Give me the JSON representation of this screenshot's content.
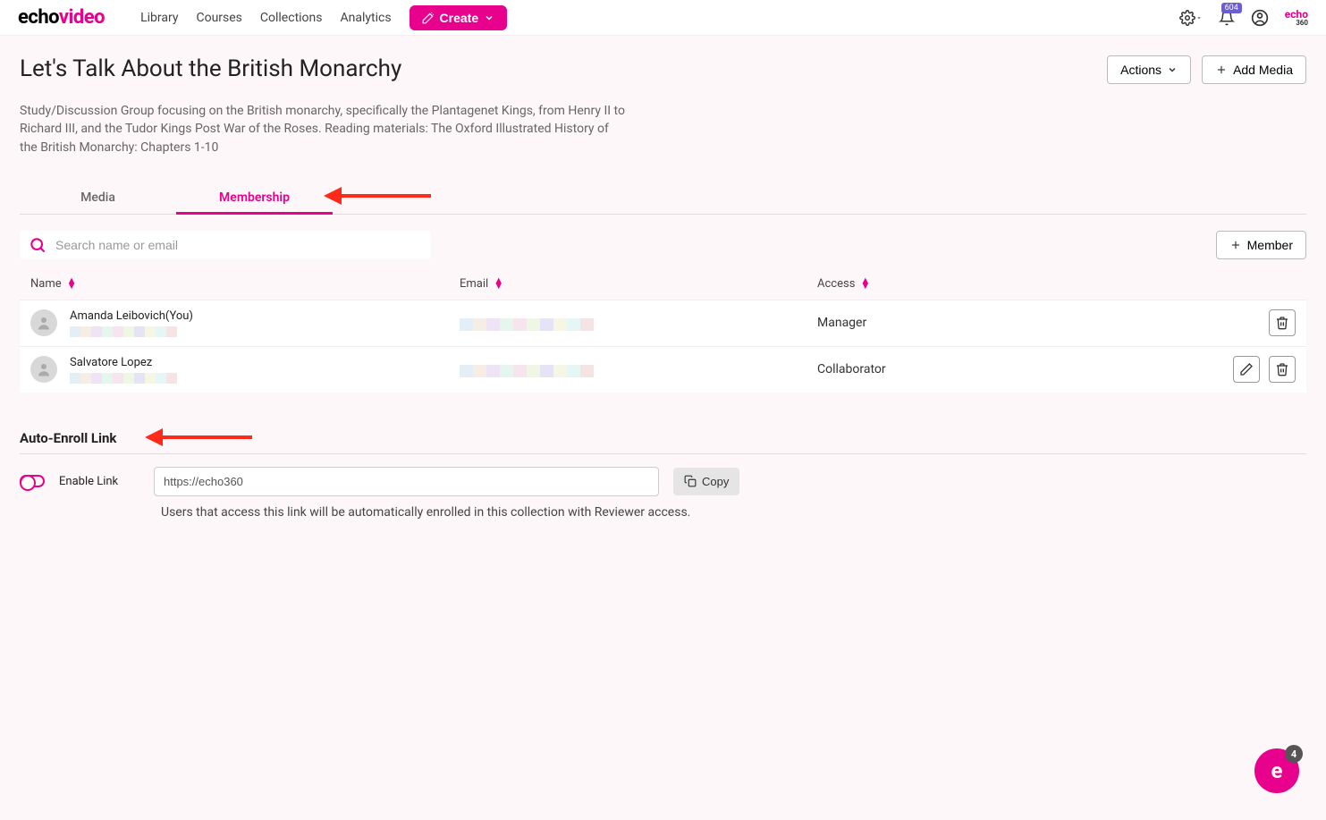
{
  "topbar": {
    "logo_part1": "echo",
    "logo_part2": "video",
    "nav": [
      "Library",
      "Courses",
      "Collections",
      "Analytics"
    ],
    "create_label": "Create",
    "notification_count": "604",
    "mini_logo": "echo",
    "mini_logo_sub": "360"
  },
  "header": {
    "title": "Let's Talk About the British Monarchy",
    "actions_label": "Actions",
    "add_media_label": "Add Media",
    "description": "Study/Discussion Group focusing on the British monarchy, specifically the Plantagenet Kings, from Henry II to Richard III, and the Tudor Kings Post War of the Roses. Reading materials: The Oxford Illustrated History of the British Monarchy: Chapters 1-10"
  },
  "tabs": {
    "media": "Media",
    "membership": "Membership"
  },
  "search": {
    "placeholder": "Search name or email"
  },
  "add_member_label": "Member",
  "table": {
    "col_name": "Name",
    "col_email": "Email",
    "col_access": "Access",
    "rows": [
      {
        "name": "Amanda Leibovich(You)",
        "access": "Manager",
        "editable": false
      },
      {
        "name": "Salvatore Lopez",
        "access": "Collaborator",
        "editable": true
      }
    ]
  },
  "auto_enroll": {
    "section_title": "Auto-Enroll Link",
    "toggle_label": "Enable Link",
    "link_value": "https://echo360",
    "copy_label": "Copy",
    "help_text": "Users that access this link will be automatically enrolled in this collection with Reviewer access."
  },
  "fab": {
    "count": "4"
  }
}
